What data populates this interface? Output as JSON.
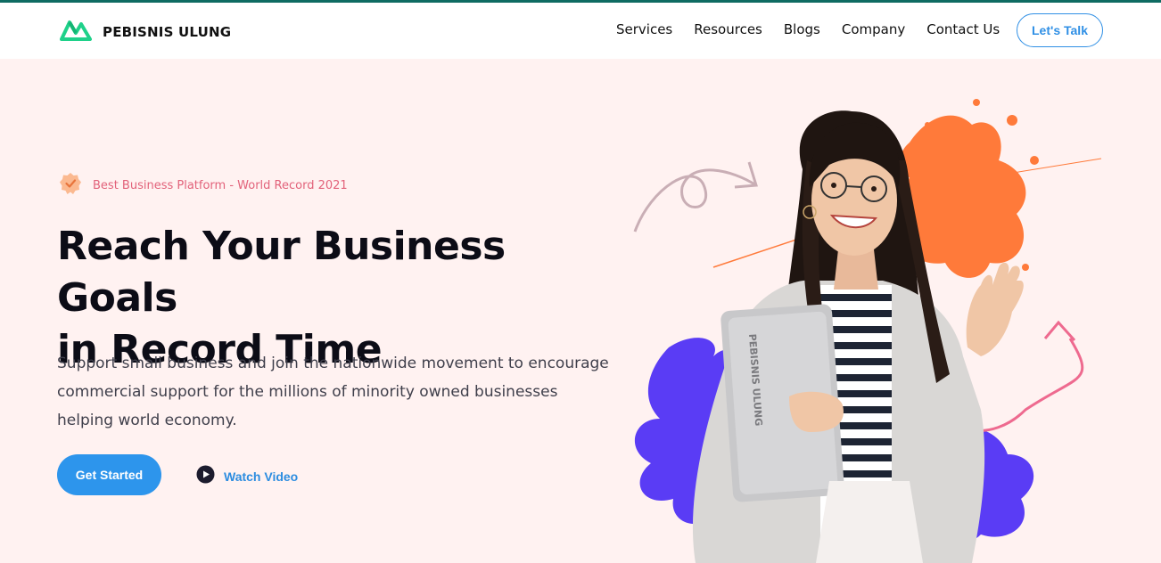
{
  "brand": {
    "name": "PEBISNIS ULUNG",
    "logo_icon": "mountain-logo-icon",
    "logo_color": "#1fd18a"
  },
  "nav": {
    "items": [
      {
        "label": "Services"
      },
      {
        "label": "Resources"
      },
      {
        "label": "Blogs"
      },
      {
        "label": "Company"
      },
      {
        "label": "Contact Us"
      }
    ],
    "cta_label": "Let's Talk"
  },
  "hero": {
    "badge_icon": "checkmark-badge-icon",
    "badge_text": "Best Business Platform - World Record 2021",
    "headline_line1": "Reach Your Business Goals",
    "headline_line2": "in Record Time",
    "description": "Support small business and join the nationwide movement to encourage commercial support for the millions of minority owned businesses helping world economy.",
    "primary_button": "Get Started",
    "video_icon": "play-icon",
    "video_label": "Watch Video",
    "laptop_text": "PEBISNIS ULUNG"
  },
  "colors": {
    "accent": "#2d95ec",
    "brand_green": "#1fd18a",
    "hero_bg": "#fff2f1",
    "splash_orange": "#ff7a3a",
    "splash_purple": "#5a3cf5",
    "badge_pink": "#e2627a"
  }
}
